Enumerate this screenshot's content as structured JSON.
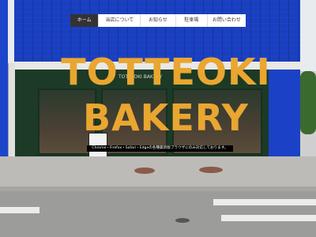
{
  "nav": {
    "items": [
      {
        "label": "ホーム"
      },
      {
        "label": "当店について"
      },
      {
        "label": "お知らせ"
      },
      {
        "label": "駐車場"
      },
      {
        "label": "お問い合わせ"
      }
    ],
    "active_index": 0
  },
  "hero": {
    "line1": "TOTTEOKI",
    "line2": "BAKERY",
    "color": "#E9A630"
  },
  "storefront_sign": "TOTTEOKI BAKERY",
  "browser_notice": "Chrome・Firefox・Safari・Edgeの各種最新版ブラウザにのみ対応しております。"
}
